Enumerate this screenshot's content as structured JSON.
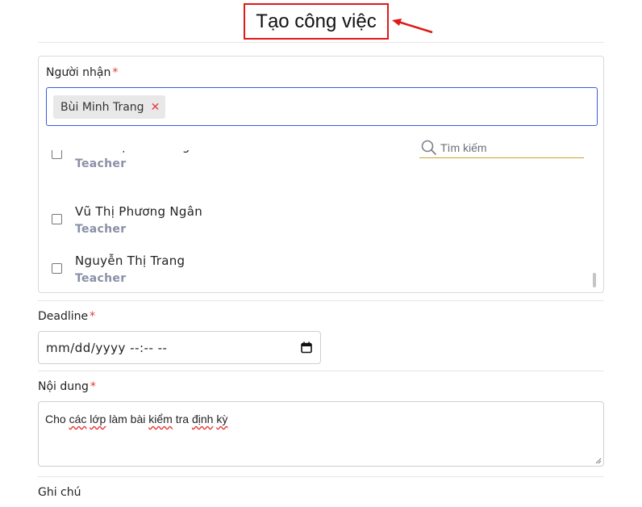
{
  "header": {
    "title": "Tạo công việc"
  },
  "recipients": {
    "label": "Người nhận",
    "required_mark": "*",
    "selected_tag": "Bùi Minh Trang",
    "remove_icon": "close-icon",
    "search_placeholder": "Tìm kiếm",
    "items": [
      {
        "name": "Kiều Thị Thu Hằng",
        "role": "Teacher",
        "checked": false
      },
      {
        "name": "Vũ Thị Phương Ngân",
        "role": "Teacher",
        "checked": false
      },
      {
        "name": "Nguyễn Thị Trang",
        "role": "Teacher",
        "checked": false
      }
    ]
  },
  "deadline": {
    "label": "Deadline",
    "required_mark": "*",
    "value": "mm/dd/yyyy --:-- --",
    "icon": "calendar-icon"
  },
  "content": {
    "label": "Nội dung",
    "required_mark": "*",
    "segments": [
      "Cho ",
      "các",
      " ",
      "lớp",
      " làm bài ",
      "kiểm",
      " tra ",
      "định",
      " ",
      "kỳ"
    ]
  },
  "note": {
    "label": "Ghi chú"
  },
  "colors": {
    "accent_border": "#3b5bdb",
    "required": "#e53935",
    "annotation": "#e01818",
    "role_text": "#8a90a6"
  }
}
